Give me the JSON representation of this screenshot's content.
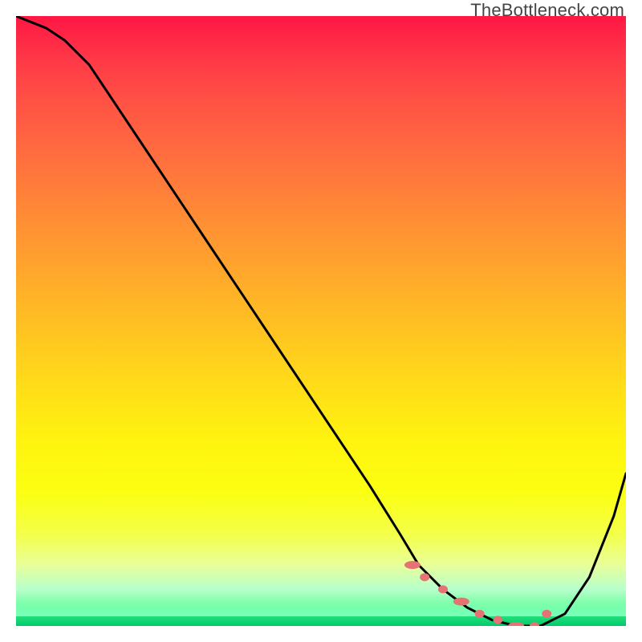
{
  "watermark_text": "TheBottleneck.com",
  "colors": {
    "curve": "#000000",
    "marker": "#e57373",
    "gradient_top": "#ff1744",
    "gradient_bottom": "#2dff7a"
  },
  "chart_data": {
    "type": "line",
    "title": "",
    "xlabel": "",
    "ylabel": "",
    "xlim": [
      0,
      100
    ],
    "ylim": [
      0,
      100
    ],
    "curve": {
      "name": "bottleneck_curve",
      "x": [
        0,
        5,
        8,
        12,
        20,
        30,
        40,
        50,
        58,
        63,
        66,
        70,
        74,
        78,
        82,
        86,
        90,
        94,
        98,
        100
      ],
      "y": [
        100,
        98,
        96,
        92,
        80,
        65,
        50,
        35,
        23,
        15,
        10,
        6,
        3,
        1,
        0,
        0,
        2,
        8,
        18,
        25
      ]
    },
    "markers": {
      "name": "bottleneck_flat_region_markers",
      "x": [
        65,
        67,
        70,
        73,
        76,
        79,
        82,
        85,
        87
      ],
      "y": [
        10,
        8,
        6,
        4,
        2,
        1,
        0,
        0,
        2
      ]
    },
    "notes": "Chart has no visible axis ticks or labels; values are approximate positions on a 0-100 normalized domain. Curve starts at top-left (~100), descends near zero around x≈82, then rises toward right edge."
  }
}
